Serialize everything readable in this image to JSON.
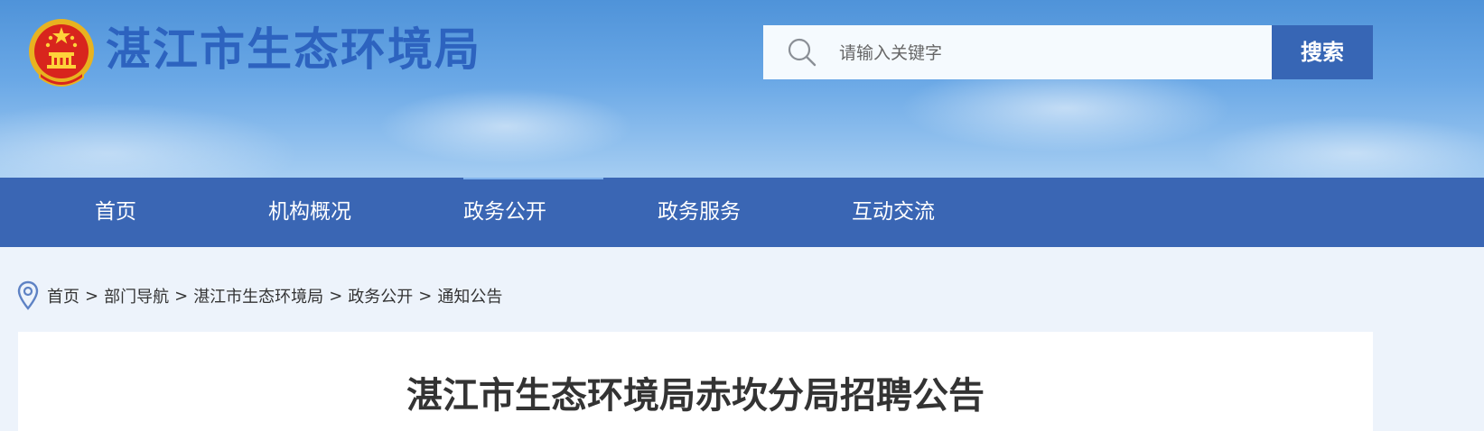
{
  "header": {
    "site_title": "湛江市生态环境局",
    "emblem_icon": "national-emblem-icon"
  },
  "search": {
    "placeholder": "请输入关键字",
    "value": "",
    "button_label": "搜索",
    "icon": "search-icon"
  },
  "nav": {
    "items": [
      {
        "label": "首页"
      },
      {
        "label": "机构概况"
      },
      {
        "label": "政务公开",
        "active": true
      },
      {
        "label": "政务服务"
      },
      {
        "label": "互动交流"
      }
    ]
  },
  "breadcrumb": {
    "icon": "location-pin-icon",
    "separator": ">",
    "items": [
      "首页",
      "部门导航",
      "湛江市生态环境局",
      "政务公开",
      "通知公告"
    ]
  },
  "article": {
    "title": "湛江市生态环境局赤坎分局招聘公告"
  },
  "colors": {
    "brand_blue": "#3a66b4",
    "title_blue": "#2d63bf",
    "page_background": "#edf3fb",
    "text_dark": "#333333"
  }
}
